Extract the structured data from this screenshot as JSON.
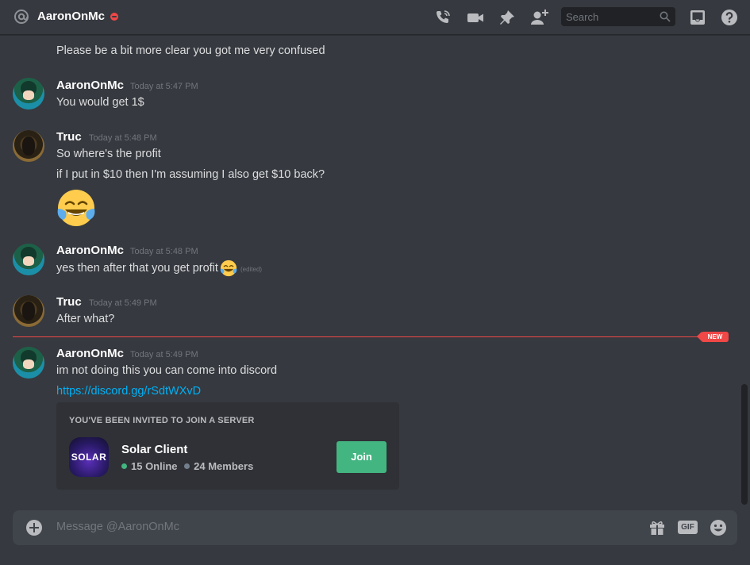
{
  "header": {
    "title": "AaronOnMc",
    "search_placeholder": "Search"
  },
  "messages": {
    "m0": {
      "text": "Please be a bit more clear you got me very confused"
    },
    "m1": {
      "author": "AaronOnMc",
      "timestamp": "Today at 5:47 PM",
      "text": "You would get 1$"
    },
    "m2": {
      "author": "Truc",
      "timestamp": "Today at 5:48 PM",
      "line1": "So where's the profit",
      "line2": "if I put in $10 then I'm assuming I also get $10 back?",
      "emoji": "joy-emoji"
    },
    "m3": {
      "author": "AaronOnMc",
      "timestamp": "Today at 5:48 PM",
      "text": "yes then after that you get profit",
      "edited": "(edited)"
    },
    "m4": {
      "author": "Truc",
      "timestamp": "Today at 5:49 PM",
      "text": "After what?"
    },
    "m5": {
      "author": "AaronOnMc",
      "timestamp": "Today at 5:49 PM",
      "text": "im not doing this you can come into discord",
      "link": "https://discord.gg/rSdtWXvD"
    }
  },
  "new_divider": {
    "label": "NEW"
  },
  "invite": {
    "heading": "YOU'VE BEEN INVITED TO JOIN A SERVER",
    "server_icon_text": "SOLAR",
    "server_name": "Solar Client",
    "online": "15 Online",
    "members": "24 Members",
    "join_label": "Join"
  },
  "composer": {
    "placeholder": "Message @AaronOnMc",
    "gif_label": "GIF"
  },
  "colors": {
    "background": "#36393f",
    "accent_link": "#00b0f4",
    "new_red": "#f04747",
    "join_green": "#43b581"
  }
}
